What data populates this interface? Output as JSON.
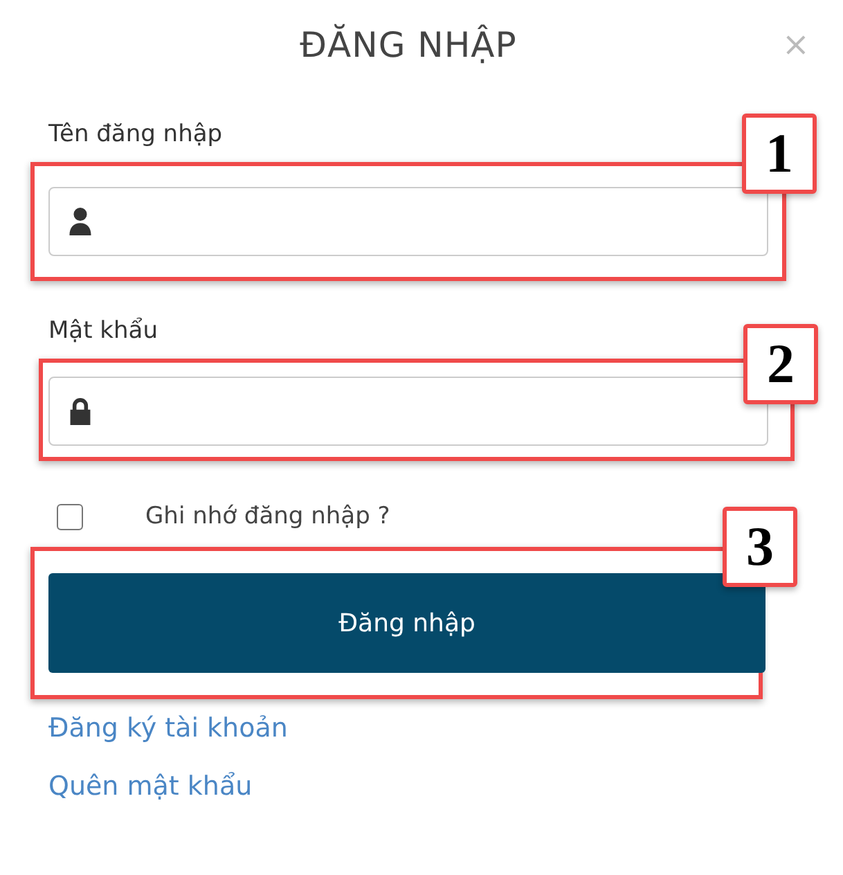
{
  "dialog": {
    "title": "ĐĂNG NHẬP",
    "close": "×"
  },
  "fields": [
    {
      "label": "Tên đăng nhập",
      "kind": "user",
      "callout": "1"
    },
    {
      "label": "Mật khẩu",
      "kind": "password",
      "callout": "2"
    }
  ],
  "remember": {
    "label": "Ghi nhớ đăng nhập ?",
    "checked": false
  },
  "submit": {
    "label": "Đăng nhập",
    "callout": "3"
  },
  "links": [
    "Đăng ký tài khoản",
    "Quên mật khẩu"
  ]
}
